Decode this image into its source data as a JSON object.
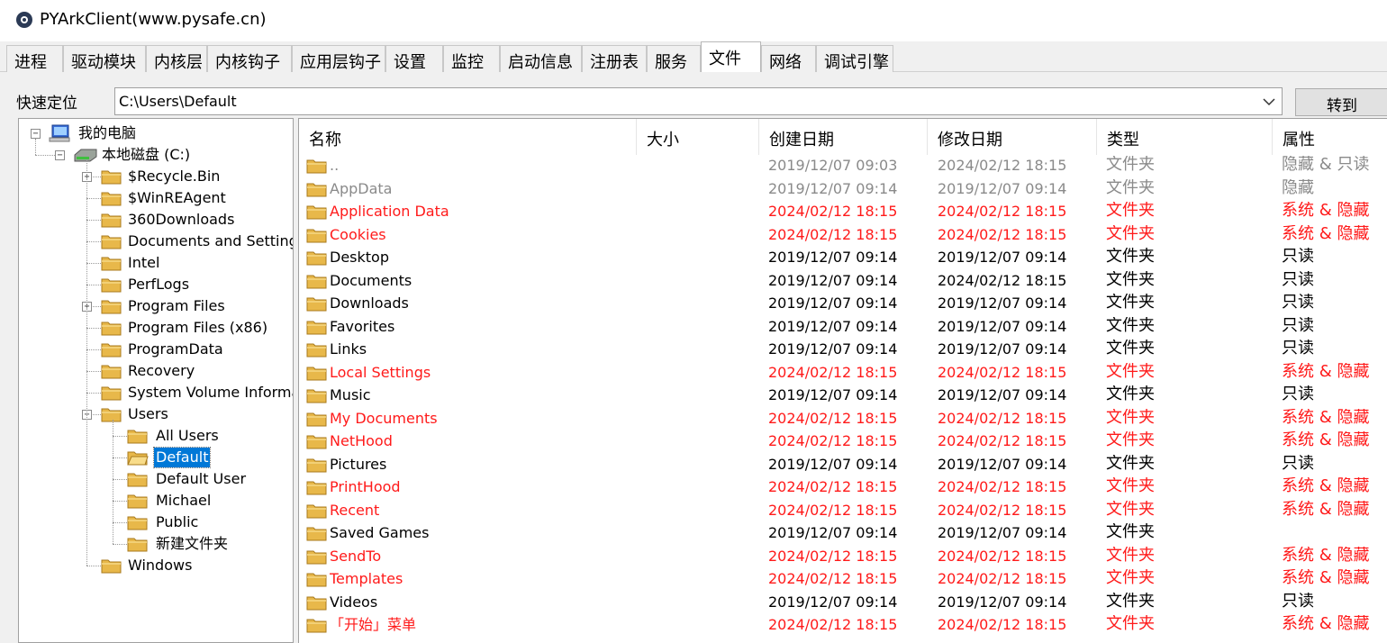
{
  "window": {
    "title": "PYArkClient(www.pysafe.cn)"
  },
  "tabs": [
    {
      "label": "进程",
      "active": false
    },
    {
      "label": "驱动模块",
      "active": false
    },
    {
      "label": "内核层",
      "active": false
    },
    {
      "label": "内核钩子",
      "active": false
    },
    {
      "label": "应用层钩子",
      "active": false
    },
    {
      "label": "设置",
      "active": false
    },
    {
      "label": "监控",
      "active": false
    },
    {
      "label": "启动信息",
      "active": false
    },
    {
      "label": "注册表",
      "active": false
    },
    {
      "label": "服务",
      "active": false
    },
    {
      "label": "文件",
      "active": true
    },
    {
      "label": "网络",
      "active": false
    },
    {
      "label": "调试引擎",
      "active": false
    }
  ],
  "location": {
    "label": "快速定位",
    "path": "C:\\Users\\Default",
    "go_label": "转到"
  },
  "tree": {
    "root": "我的电脑",
    "disk": "本地磁盘 (C:)",
    "items": [
      "$Recycle.Bin",
      "$WinREAgent",
      "360Downloads",
      "Documents and Settings",
      "Intel",
      "PerfLogs",
      "Program Files",
      "Program Files (x86)",
      "ProgramData",
      "Recovery",
      "System Volume Informati",
      "Users"
    ],
    "users_children": [
      "All Users",
      "Default",
      "Default User",
      "Michael",
      "Public",
      "新建文件夹"
    ],
    "last": "Windows",
    "selected": "Default"
  },
  "columns": [
    "名称",
    "大小",
    "创建日期",
    "修改日期",
    "类型",
    "属性"
  ],
  "colors": {
    "hidden": "#8a8a8a",
    "system": "#ff1a1a",
    "normal": "#000000",
    "selected": "#0078d7"
  },
  "rows": [
    {
      "name": "..",
      "ctime": "2019/12/07 09:03",
      "mtime": "2024/02/12 18:15",
      "type": "文件夹",
      "attr": "隐藏 & 只读",
      "style": "hidden"
    },
    {
      "name": "AppData",
      "ctime": "2019/12/07 09:14",
      "mtime": "2019/12/07 09:14",
      "type": "文件夹",
      "attr": "隐藏",
      "style": "hidden"
    },
    {
      "name": "Application Data",
      "ctime": "2024/02/12 18:15",
      "mtime": "2024/02/12 18:15",
      "type": "文件夹",
      "attr": "系统 & 隐藏",
      "style": "system"
    },
    {
      "name": "Cookies",
      "ctime": "2024/02/12 18:15",
      "mtime": "2024/02/12 18:15",
      "type": "文件夹",
      "attr": "系统 & 隐藏",
      "style": "system"
    },
    {
      "name": "Desktop",
      "ctime": "2019/12/07 09:14",
      "mtime": "2019/12/07 09:14",
      "type": "文件夹",
      "attr": "只读",
      "style": "normal"
    },
    {
      "name": "Documents",
      "ctime": "2019/12/07 09:14",
      "mtime": "2024/02/12 18:15",
      "type": "文件夹",
      "attr": "只读",
      "style": "normal"
    },
    {
      "name": "Downloads",
      "ctime": "2019/12/07 09:14",
      "mtime": "2019/12/07 09:14",
      "type": "文件夹",
      "attr": "只读",
      "style": "normal"
    },
    {
      "name": "Favorites",
      "ctime": "2019/12/07 09:14",
      "mtime": "2019/12/07 09:14",
      "type": "文件夹",
      "attr": "只读",
      "style": "normal"
    },
    {
      "name": "Links",
      "ctime": "2019/12/07 09:14",
      "mtime": "2019/12/07 09:14",
      "type": "文件夹",
      "attr": "只读",
      "style": "normal"
    },
    {
      "name": "Local Settings",
      "ctime": "2024/02/12 18:15",
      "mtime": "2024/02/12 18:15",
      "type": "文件夹",
      "attr": "系统 & 隐藏",
      "style": "system"
    },
    {
      "name": "Music",
      "ctime": "2019/12/07 09:14",
      "mtime": "2019/12/07 09:14",
      "type": "文件夹",
      "attr": "只读",
      "style": "normal"
    },
    {
      "name": "My Documents",
      "ctime": "2024/02/12 18:15",
      "mtime": "2024/02/12 18:15",
      "type": "文件夹",
      "attr": "系统 & 隐藏",
      "style": "system"
    },
    {
      "name": "NetHood",
      "ctime": "2024/02/12 18:15",
      "mtime": "2024/02/12 18:15",
      "type": "文件夹",
      "attr": "系统 & 隐藏",
      "style": "system"
    },
    {
      "name": "Pictures",
      "ctime": "2019/12/07 09:14",
      "mtime": "2019/12/07 09:14",
      "type": "文件夹",
      "attr": "只读",
      "style": "normal"
    },
    {
      "name": "PrintHood",
      "ctime": "2024/02/12 18:15",
      "mtime": "2024/02/12 18:15",
      "type": "文件夹",
      "attr": "系统 & 隐藏",
      "style": "system"
    },
    {
      "name": "Recent",
      "ctime": "2024/02/12 18:15",
      "mtime": "2024/02/12 18:15",
      "type": "文件夹",
      "attr": "系统 & 隐藏",
      "style": "system"
    },
    {
      "name": "Saved Games",
      "ctime": "2019/12/07 09:14",
      "mtime": "2019/12/07 09:14",
      "type": "文件夹",
      "attr": "",
      "style": "normal"
    },
    {
      "name": "SendTo",
      "ctime": "2024/02/12 18:15",
      "mtime": "2024/02/12 18:15",
      "type": "文件夹",
      "attr": "系统 & 隐藏",
      "style": "system"
    },
    {
      "name": "Templates",
      "ctime": "2024/02/12 18:15",
      "mtime": "2024/02/12 18:15",
      "type": "文件夹",
      "attr": "系统 & 隐藏",
      "style": "system"
    },
    {
      "name": "Videos",
      "ctime": "2019/12/07 09:14",
      "mtime": "2019/12/07 09:14",
      "type": "文件夹",
      "attr": "只读",
      "style": "normal"
    },
    {
      "name": "「开始」菜单",
      "ctime": "2024/02/12 18:15",
      "mtime": "2024/02/12 18:15",
      "type": "文件夹",
      "attr": "系统 & 隐藏",
      "style": "system"
    }
  ]
}
